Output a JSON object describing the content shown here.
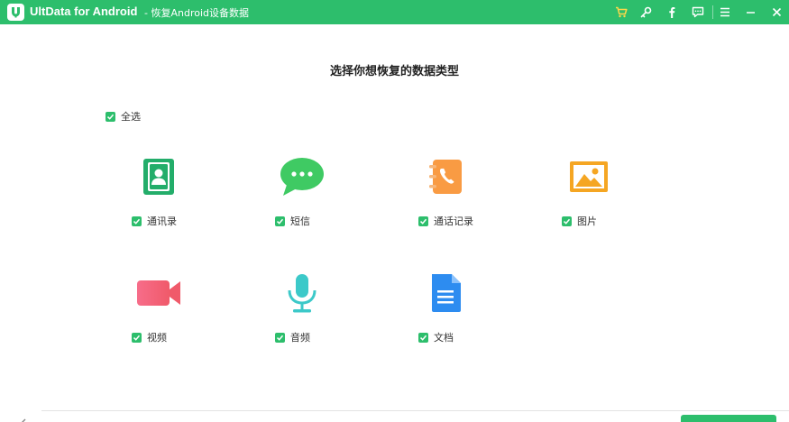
{
  "window": {
    "app_name": "UltData for Android",
    "subtitle": "- 恢复Android设备数据"
  },
  "toolbar": {
    "icons": [
      "cart-icon",
      "key-icon",
      "facebook-icon",
      "feedback-icon",
      "menu-icon",
      "minimize-icon",
      "close-icon"
    ]
  },
  "main": {
    "heading": "选择你想恢复的数据类型",
    "select_all_label": "全选",
    "categories": [
      {
        "label": "通讯录",
        "icon": "contacts-icon",
        "color": "#23ad6a",
        "checked": true
      },
      {
        "label": "短信",
        "icon": "messages-icon",
        "color": "#3fca63",
        "checked": true
      },
      {
        "label": "通话记录",
        "icon": "call-log-icon",
        "color": "#f99b43",
        "checked": true
      },
      {
        "label": "图片",
        "icon": "photos-icon",
        "color": "#f5a623",
        "checked": true
      },
      {
        "label": "视频",
        "icon": "video-icon",
        "color": "#f2687b",
        "checked": true
      },
      {
        "label": "音频",
        "icon": "audio-icon",
        "color": "#3cc9c9",
        "checked": true
      },
      {
        "label": "文档",
        "icon": "document-icon",
        "color": "#2d8cf0",
        "checked": true
      }
    ]
  },
  "colors": {
    "brand_green": "#2dbe6c"
  }
}
